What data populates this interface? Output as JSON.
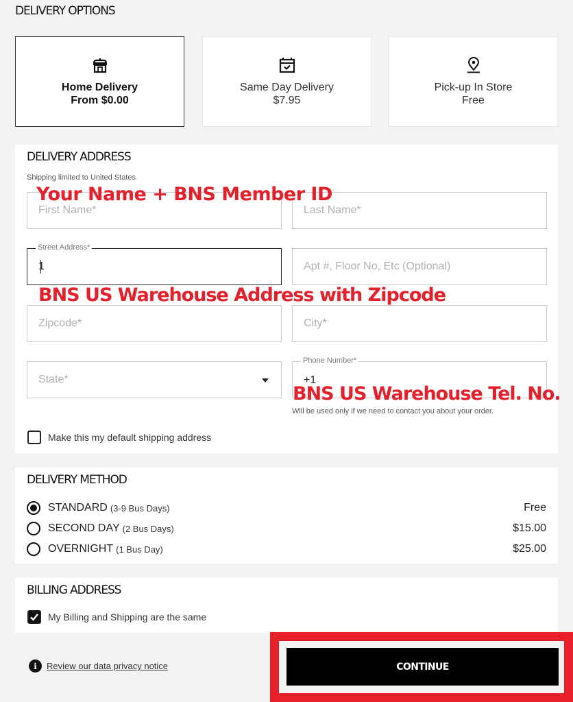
{
  "delivery_options": {
    "title": "DELIVERY OPTIONS",
    "options": [
      {
        "icon": "store-icon",
        "name": "Home Delivery",
        "price": "From $0.00",
        "selected": true
      },
      {
        "icon": "calendar-check-icon",
        "name": "Same Day Delivery",
        "price": "$7.95",
        "selected": false
      },
      {
        "icon": "map-pin-icon",
        "name": "Pick-up In Store",
        "price": "Free",
        "selected": false
      }
    ]
  },
  "delivery_address": {
    "title": "DELIVERY ADDRESS",
    "shipping_note": "Shipping limited to United States",
    "fields": {
      "first_name": {
        "placeholder": "First Name*",
        "value": ""
      },
      "last_name": {
        "placeholder": "Last Name*",
        "value": ""
      },
      "street": {
        "label": "Street Address*",
        "value": "1"
      },
      "apt": {
        "placeholder": "Apt #, Floor No, Etc (Optional)",
        "value": ""
      },
      "zipcode": {
        "placeholder": "Zipcode*",
        "value": ""
      },
      "city": {
        "placeholder": "City*",
        "value": ""
      },
      "state": {
        "placeholder": "State*",
        "value": ""
      },
      "phone": {
        "label": "Phone Number*",
        "value": "+1"
      }
    },
    "phone_hint": "Will be used only if we need to contact you about your order.",
    "default_checkbox": {
      "label": "Make this my default shipping address",
      "checked": false
    }
  },
  "delivery_method": {
    "title": "DELIVERY METHOD",
    "methods": [
      {
        "name": "STANDARD",
        "days": "(3-9 Bus Days)",
        "price": "Free",
        "selected": true
      },
      {
        "name": "SECOND DAY",
        "days": "(2 Bus Days)",
        "price": "$15.00",
        "selected": false
      },
      {
        "name": "OVERNIGHT",
        "days": "(1 Bus Day)",
        "price": "$25.00",
        "selected": false
      }
    ]
  },
  "billing_address": {
    "title": "BILLING ADDRESS",
    "same_checkbox": {
      "label": "My Billing and Shipping are the same",
      "checked": true
    }
  },
  "footer": {
    "privacy_link": "Review our data privacy notice",
    "continue_label": "CONTINUE"
  },
  "annotations": {
    "name_hint": "Your Name + BNS Member ID",
    "address_hint": "BNS US Warehouse Address with Zipcode",
    "tel_hint": "BNS US Warehouse Tel. No.",
    "color": "#e3202b"
  },
  "colors": {
    "background": "#f3f3f3",
    "button": "#000000",
    "highlight": "#e8202a"
  }
}
